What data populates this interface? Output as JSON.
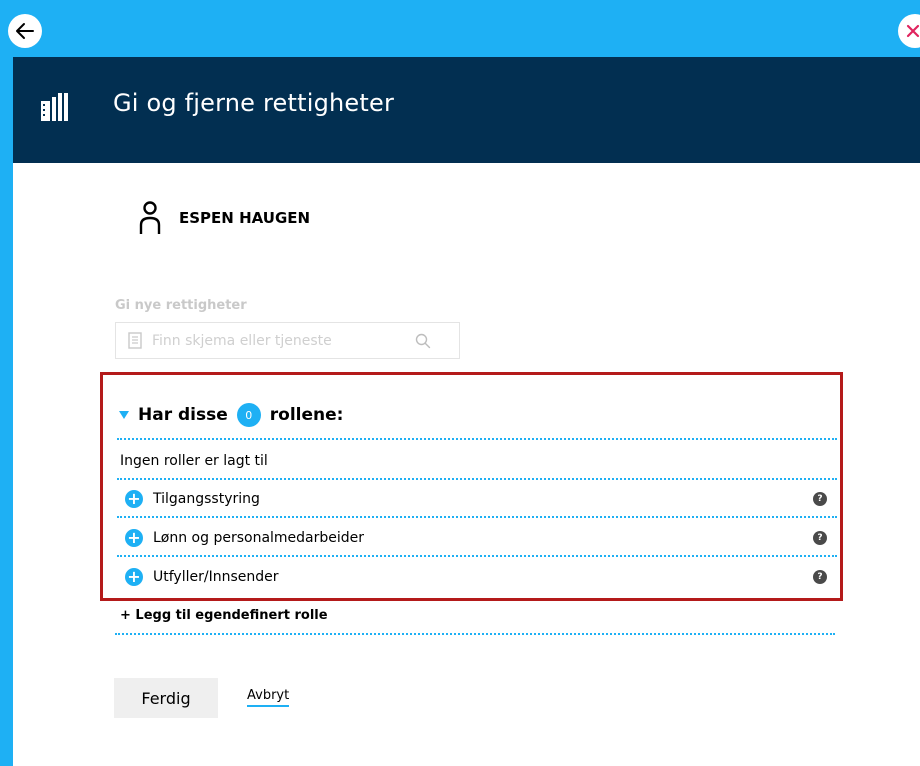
{
  "colors": {
    "background": "#1eb0f4",
    "header": "#022f51",
    "accent": "#1eb0f4",
    "highlight_border": "#b41a1a",
    "close_icon": "#e0245e"
  },
  "topbar": {
    "back_icon": "arrow-left-icon",
    "close_icon": "close-icon"
  },
  "header": {
    "icon": "building-icon",
    "title": "Gi og fjerne rettigheter"
  },
  "user": {
    "icon": "person-icon",
    "name": "ESPEN HAUGEN"
  },
  "new_rights": {
    "label": "Gi nye rettigheter",
    "search_placeholder": "Finn skjema eller tjeneste",
    "search_value": ""
  },
  "roles": {
    "heading_prefix": "Har disse",
    "count": "0",
    "heading_suffix": "rollene:",
    "empty_text": "Ingen roller er lagt til",
    "items": [
      {
        "label": "Tilgangsstyring",
        "help": "?"
      },
      {
        "label": "Lønn og personalmedarbeider",
        "help": "?"
      },
      {
        "label": "Utfyller/Innsender",
        "help": "?"
      }
    ]
  },
  "custom_role": {
    "label": "+ Legg til egendefinert rolle"
  },
  "actions": {
    "done_label": "Ferdig",
    "cancel_label": "Avbryt"
  }
}
